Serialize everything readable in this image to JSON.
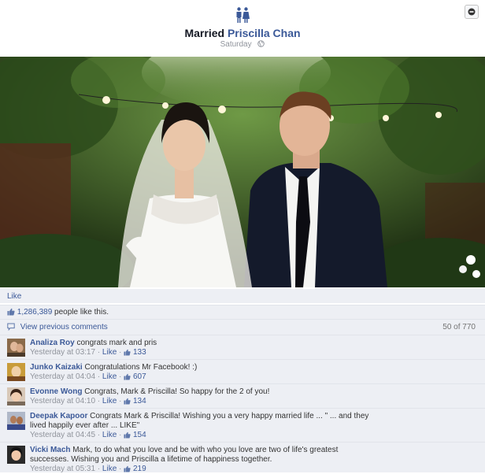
{
  "header": {
    "event": "Married",
    "person": "Priscilla Chan",
    "date": "Saturday"
  },
  "actions": {
    "like_label": "Like"
  },
  "likes": {
    "count": "1,286,389",
    "suffix": " people like this."
  },
  "comments_bar": {
    "view_previous": "View previous comments",
    "count_text": "50 of 770"
  },
  "comments": [
    {
      "name": "Analiza Roy",
      "text": "congrats mark and pris",
      "time": "Yesterday at 03:17",
      "like": "Like",
      "likes": "133"
    },
    {
      "name": "Junko Kaizaki",
      "text": "Congratulations Mr Facebook! :)",
      "time": "Yesterday at 04:04",
      "like": "Like",
      "likes": "607"
    },
    {
      "name": "Evonne Wong",
      "text": "Congrats, Mark & Priscilla! So happy for the 2 of you!",
      "time": "Yesterday at 04:10",
      "like": "Like",
      "likes": "134"
    },
    {
      "name": "Deepak Kapoor",
      "text": "Congrats Mark & Priscilla! Wishing you a very happy married life ... \" ... and they lived happily ever after ... LIKE\"",
      "time": "Yesterday at 04:45",
      "like": "Like",
      "likes": "154"
    },
    {
      "name": "Vicki Mach",
      "text": "Mark, to do what you love and be with who you love are two of life's greatest successes. Wishing you and Priscilla a lifetime of happiness together.",
      "time": "Yesterday at 05:31",
      "like": "Like",
      "likes": "219"
    }
  ],
  "colors": {
    "link": "#3b5998",
    "panel": "#edeff4",
    "muted": "#90949c"
  },
  "icons": [
    "couple-icon",
    "globe-icon",
    "options-icon",
    "thumbs-up-icon",
    "speech-bubble-icon"
  ]
}
